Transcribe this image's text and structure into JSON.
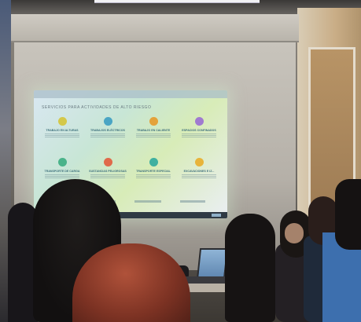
{
  "slide": {
    "heading": "SERVICIOS PARA ACTIVIDADES DE ALTO RIESGO",
    "tiles": [
      {
        "label": "TRABAJO EN ALTURAS",
        "color": "#d4c84a"
      },
      {
        "label": "TRABAJOS ELÉCTRICOS",
        "color": "#4aa5c4"
      },
      {
        "label": "TRABAJO EN CALIENTE",
        "color": "#e4a23a"
      },
      {
        "label": "ESPACIOS CONFINADOS",
        "color": "#a07ad0"
      },
      {
        "label": "TRANSPORTE DE CARGA",
        "color": "#4ab38a"
      },
      {
        "label": "SUSTANCIAS PELIGROSAS",
        "color": "#e06a4a"
      },
      {
        "label": "TRANSPORTE ESPECIAL",
        "color": "#3fb0a0"
      },
      {
        "label": "EXCAVACIONES E IZ...",
        "color": "#e8b43a"
      }
    ]
  }
}
